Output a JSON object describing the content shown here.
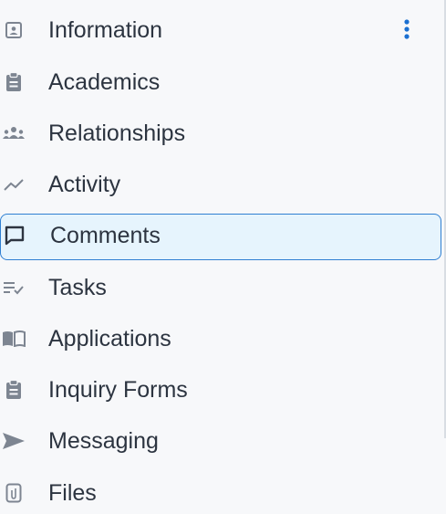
{
  "menu": {
    "items": [
      {
        "label": "Information",
        "icon": "contact-card-icon"
      },
      {
        "label": "Academics",
        "icon": "clipboard-icon"
      },
      {
        "label": "Relationships",
        "icon": "people-group-icon"
      },
      {
        "label": "Activity",
        "icon": "trend-line-icon"
      },
      {
        "label": "Comments",
        "icon": "comment-bubble-icon",
        "active": true
      },
      {
        "label": "Tasks",
        "icon": "checklist-icon"
      },
      {
        "label": "Applications",
        "icon": "open-book-icon"
      },
      {
        "label": "Inquiry Forms",
        "icon": "clipboard-icon"
      },
      {
        "label": "Messaging",
        "icon": "send-arrow-icon"
      },
      {
        "label": "Files",
        "icon": "attachment-file-icon"
      }
    ],
    "more_icon": "vertical-ellipsis-icon"
  },
  "colors": {
    "active_border": "#2f7fd2",
    "active_background": "#e6f4fd",
    "text": "#2c3440",
    "icon": "#7d8591",
    "kebab": "#1a6fd1"
  }
}
